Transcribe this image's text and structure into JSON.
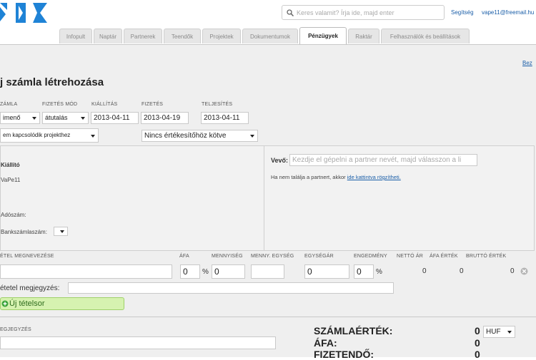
{
  "header": {
    "search_placeholder": "Keres valamit? Írja ide, majd enter",
    "help_link": "Segítség",
    "user_email": "vape11@freemail.hu",
    "tabs": [
      {
        "label": "Infopult",
        "active": false
      },
      {
        "label": "Naptár",
        "active": false
      },
      {
        "label": "Partnerek",
        "active": false
      },
      {
        "label": "Teendők",
        "active": false
      },
      {
        "label": "Projektek",
        "active": false
      },
      {
        "label": "Dokumentumok",
        "active": false
      },
      {
        "label": "Pénzügyek",
        "active": true
      },
      {
        "label": "Raktár",
        "active": false
      },
      {
        "label": "Felhasználók és beállítások",
        "active": false
      }
    ]
  },
  "top_link": "Bez",
  "page_title": "j számla létrehozása",
  "form": {
    "labels": {
      "szamla": "ZÁMLA",
      "fizetes_mod": "FIZETÉS MÓD",
      "kiallitas": "KIÁLLÍTÁS",
      "fizetes": "FIZETÉS",
      "teljesites": "TELJESÍTÉS"
    },
    "szamla_value": "imenő",
    "fizetes_mod_value": "átutalás",
    "kiallitas_value": "2013-04-11",
    "fizetes_value": "2013-04-19",
    "teljesites_value": "2013-04-11",
    "project_select": "em kapcsolódik projekthez",
    "sales_select": "Nincs értékesítőhöz kötve"
  },
  "issuer": {
    "label": "Kiállító",
    "name": "VaPe11",
    "tax_label": "Adószám:",
    "bank_label": "Bankszámlaszám:"
  },
  "buyer": {
    "label": "Vevő:",
    "placeholder": "Kezdje el gépelni a partner nevét, majd válasszon a li",
    "not_found_text": "Ha nem találja a partnert, akkor",
    "not_found_link": "ide kattintva rögzítheti."
  },
  "items": {
    "headers": {
      "name": "ÉTEL MEGNEVEZÉSE",
      "vat": "ÁFA",
      "qty": "MENNYISÉG",
      "unit": "MENNY. EGYSÉG",
      "unit_price": "EGYSÉGÁR",
      "discount": "ENGEDMÉNY",
      "net": "NETTÓ ÁR",
      "vat_value": "ÁFA ÉRTÉK",
      "gross": "BRUTTÓ ÉRTÉK"
    },
    "row": {
      "vat": "0",
      "vat_unit": "%",
      "qty": "0",
      "unit_price": "0",
      "discount": "0",
      "discount_unit": "%",
      "net": "0",
      "vat_value": "0",
      "gross": "0"
    },
    "row_note_label": "étetel megjegyzés:",
    "add_row_button": "Új tételsor"
  },
  "notes_label": "EGJEGYZÉS",
  "summary": {
    "total_label": "SZÁMLAÉRTÉK:",
    "total_value": "0",
    "currency": "HUF",
    "vat_label": "ÁFA:",
    "vat_value": "0",
    "payable_label": "FIZETENDŐ:",
    "payable_value": "0"
  },
  "colors": {
    "logo_blue": "#1f83d6",
    "link": "#1a5ea8",
    "add_button_bg": "#d6f2b0",
    "add_icon": "#3aa43a"
  }
}
